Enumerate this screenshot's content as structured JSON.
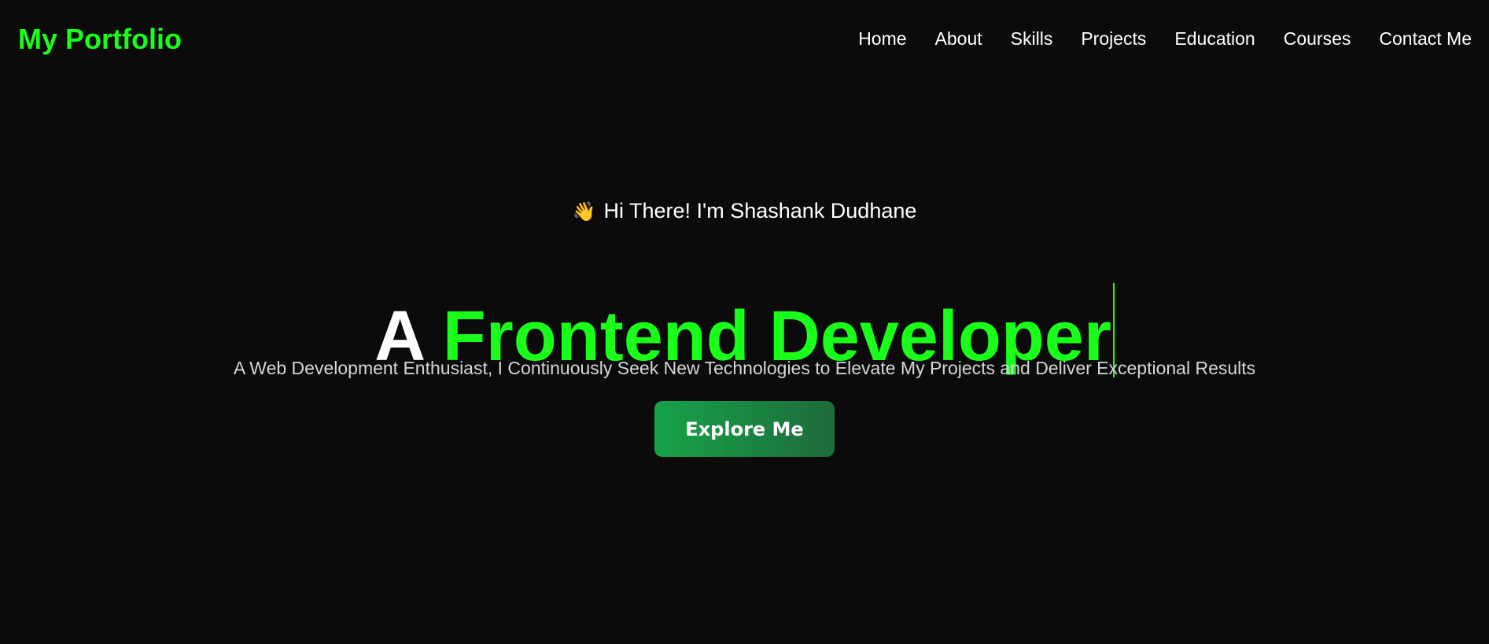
{
  "navbar": {
    "brand": "My Portfolio",
    "links": [
      "Home",
      "About",
      "Skills",
      "Projects",
      "Education",
      "Courses",
      "Contact Me"
    ]
  },
  "hero": {
    "wave_icon": "👋",
    "greeting": "Hi There! I'm Shashank Dudhane",
    "headline_lead": "A",
    "headline_role": "Frontend Developer",
    "tagline": "A Web Development Enthusiast, I Continuously Seek New Technologies to Elevate My Projects and Deliver Exceptional Results",
    "cta_label": "Explore Me"
  },
  "colors": {
    "background": "#0b0b0b",
    "accent": "#1aff1a",
    "text": "#ffffff",
    "muted_text": "#d6d6d6",
    "button_start": "#16a34a",
    "button_end": "#1e6b3a"
  }
}
